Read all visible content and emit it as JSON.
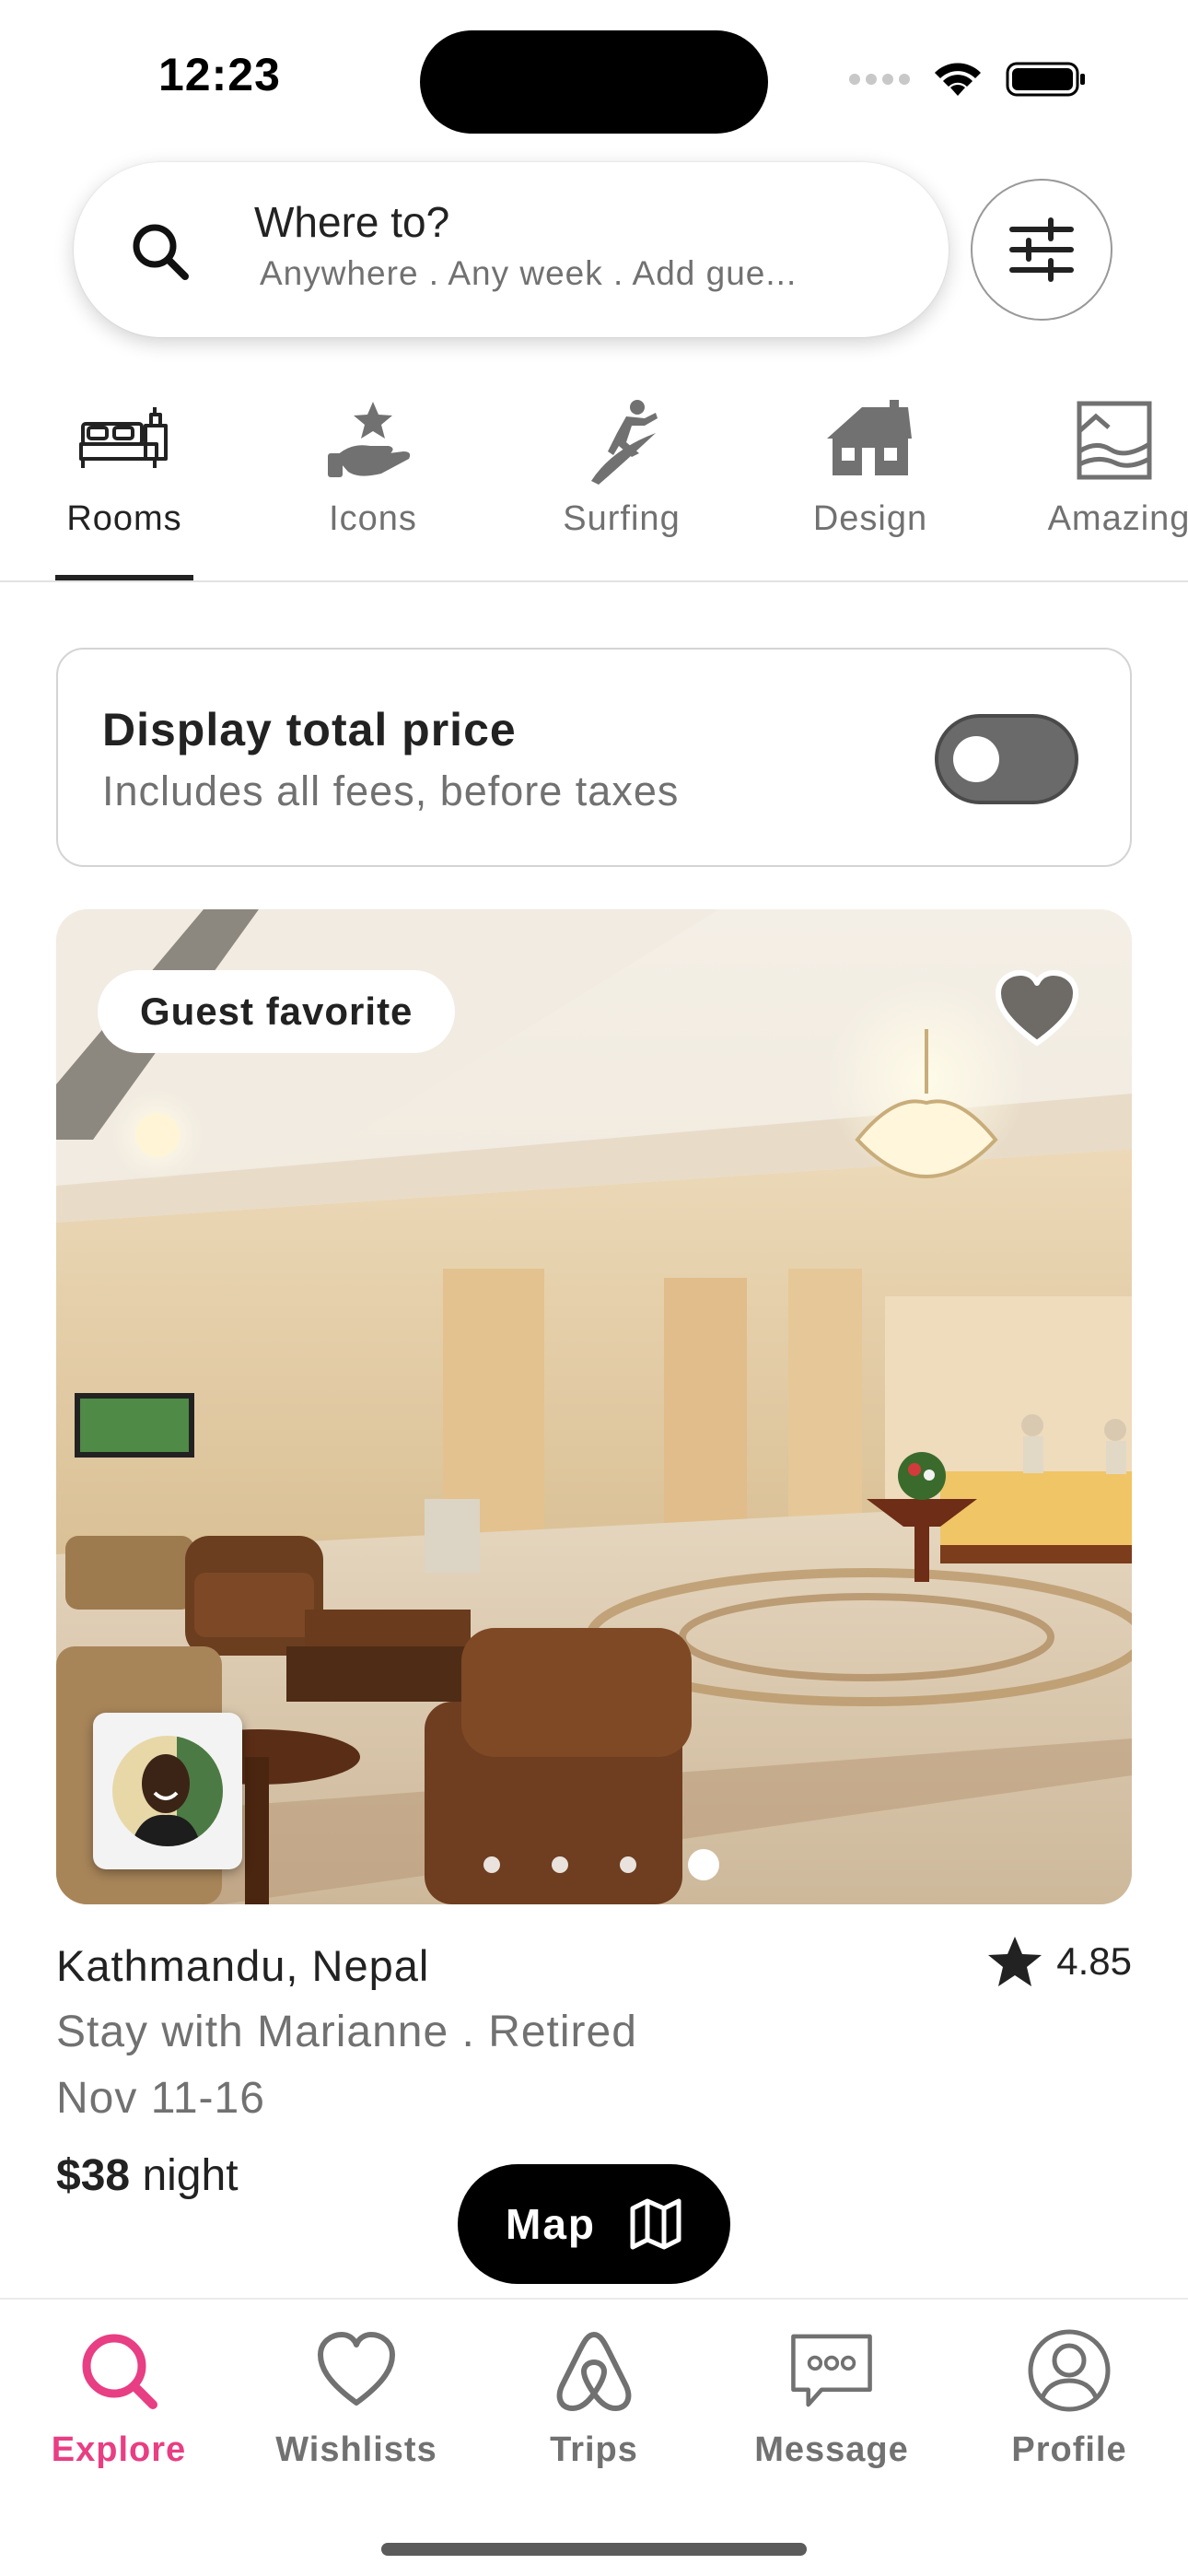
{
  "status_bar": {
    "time": "12:23"
  },
  "search": {
    "title": "Where to?",
    "subtitle": "Anywhere . Any week . Add gue..."
  },
  "categories": [
    {
      "label": "Rooms",
      "icon": "bed-icon",
      "active": true
    },
    {
      "label": "Icons",
      "icon": "hand-star-icon",
      "active": false
    },
    {
      "label": "Surfing",
      "icon": "surfer-icon",
      "active": false
    },
    {
      "label": "Design",
      "icon": "house-icon",
      "active": false
    },
    {
      "label": "Amazing",
      "icon": "amazing-view-icon",
      "active": false
    }
  ],
  "price_toggle": {
    "title": "Display total price",
    "subtitle": "Includes all fees, before taxes",
    "on": false
  },
  "listing": {
    "badge": "Guest favorite",
    "photo_index": 4,
    "photo_count": 4,
    "location": "Kathmandu, Nepal",
    "rating": "4.85",
    "host_line": "Stay with Marianne . Retired",
    "dates": "Nov 11-16",
    "price_amount": "$38",
    "price_unit": "night"
  },
  "map_button": {
    "label": "Map"
  },
  "nav": {
    "items": [
      {
        "label": "Explore",
        "icon": "search-icon",
        "active": true
      },
      {
        "label": "Wishlists",
        "icon": "heart-icon",
        "active": false
      },
      {
        "label": "Trips",
        "icon": "airbnb-logo-icon",
        "active": false
      },
      {
        "label": "Message",
        "icon": "message-icon",
        "active": false
      },
      {
        "label": "Profile",
        "icon": "profile-icon",
        "active": false
      }
    ]
  },
  "colors": {
    "accent": "#e83e83",
    "text_primary": "#222222",
    "text_secondary": "#717171"
  }
}
